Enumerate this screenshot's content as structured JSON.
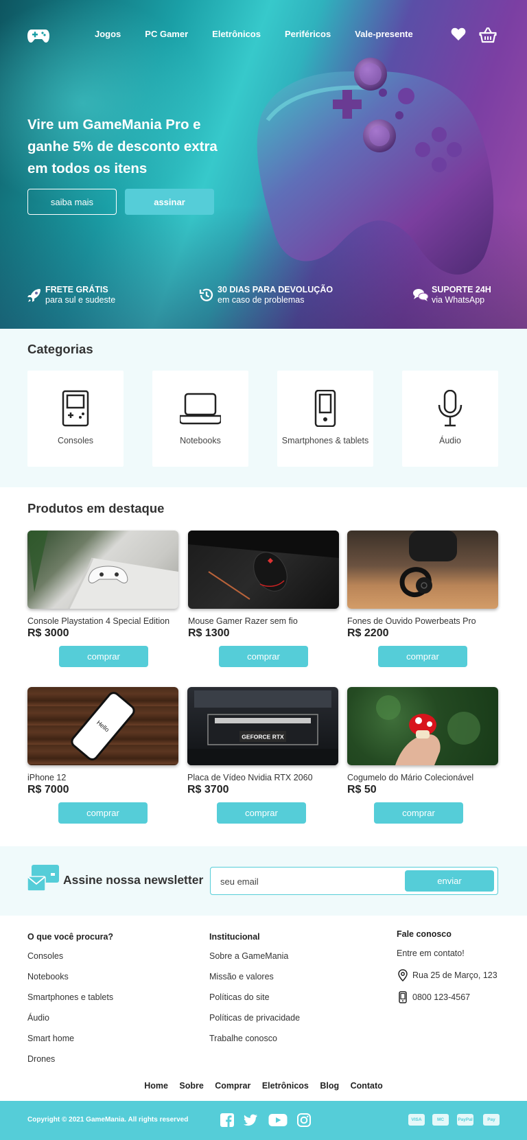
{
  "nav": {
    "items": [
      "Jogos",
      "PC Gamer",
      "Eletrônicos",
      "Periféricos",
      "Vale-presente"
    ]
  },
  "hero": {
    "title": "Vire um GameMania Pro e ganhe 5% de desconto extra em todos os itens",
    "btn_more": "saiba mais",
    "btn_subscribe": "assinar"
  },
  "features": [
    {
      "icon": "rocket-icon",
      "title": "FRETE GRÁTIS",
      "subtitle": "para sul e sudeste"
    },
    {
      "icon": "history-icon",
      "title": "30 DIAS PARA DEVOLUÇÃO",
      "subtitle": "em caso de problemas"
    },
    {
      "icon": "chat-icon",
      "title": "SUPORTE 24H",
      "subtitle": "via WhatsApp"
    }
  ],
  "categories": {
    "title": "Categorias",
    "items": [
      {
        "icon": "gameboy-icon",
        "label": "Consoles"
      },
      {
        "icon": "laptop-icon",
        "label": "Notebooks"
      },
      {
        "icon": "smartphone-icon",
        "label": "Smartphones & tablets"
      },
      {
        "icon": "microphone-icon",
        "label": "Áudio"
      }
    ]
  },
  "products": {
    "title": "Produtos em destaque",
    "buy_label": "comprar",
    "items": [
      {
        "name": "Console Playstation 4 Special Edition",
        "price": "R$ 3000"
      },
      {
        "name": "Mouse Gamer Razer sem fio",
        "price": "R$ 1300"
      },
      {
        "name": "Fones de Ouvido Powerbeats Pro",
        "price": "R$ 2200"
      },
      {
        "name": "iPhone 12",
        "price": "R$ 7000",
        "image_text": "Hello"
      },
      {
        "name": "Placa de Vídeo Nvidia RTX 2060",
        "price": "R$ 3700",
        "image_text": "GEFORCE RTX"
      },
      {
        "name": "Cogumelo do Mário Colecionável",
        "price": "R$ 50"
      }
    ]
  },
  "newsletter": {
    "title": "Assine nossa newsletter",
    "placeholder": "seu email",
    "button": "enviar"
  },
  "footer": {
    "col1": {
      "title": "O que você procura?",
      "links": [
        "Consoles",
        "Notebooks",
        "Smartphones e tablets",
        "Áudio",
        "Smart home",
        "Drones"
      ]
    },
    "col2": {
      "title": "Institucional",
      "links": [
        "Sobre a GameMania",
        "Missão e valores",
        "Políticas do site",
        "Políticas de privacidade",
        "Trabalhe conosco"
      ]
    },
    "col3": {
      "title": "Fale conosco",
      "intro": "Entre em contato!",
      "address": "Rua 25 de Março, 123",
      "phone": "0800 123-4567"
    },
    "bottom_nav": [
      "Home",
      "Sobre",
      "Comprar",
      "Eletrônicos",
      "Blog",
      "Contato"
    ],
    "copyright": "Copyright © 2021 GameMania. All rights reserved",
    "social": [
      "facebook-icon",
      "twitter-icon",
      "youtube-icon",
      "instagram-icon"
    ],
    "payments": [
      "VISA",
      "MC",
      "PayPal",
      "Pay"
    ]
  },
  "colors": {
    "accent": "#55cdd8",
    "light_bg": "#f0fafb"
  }
}
